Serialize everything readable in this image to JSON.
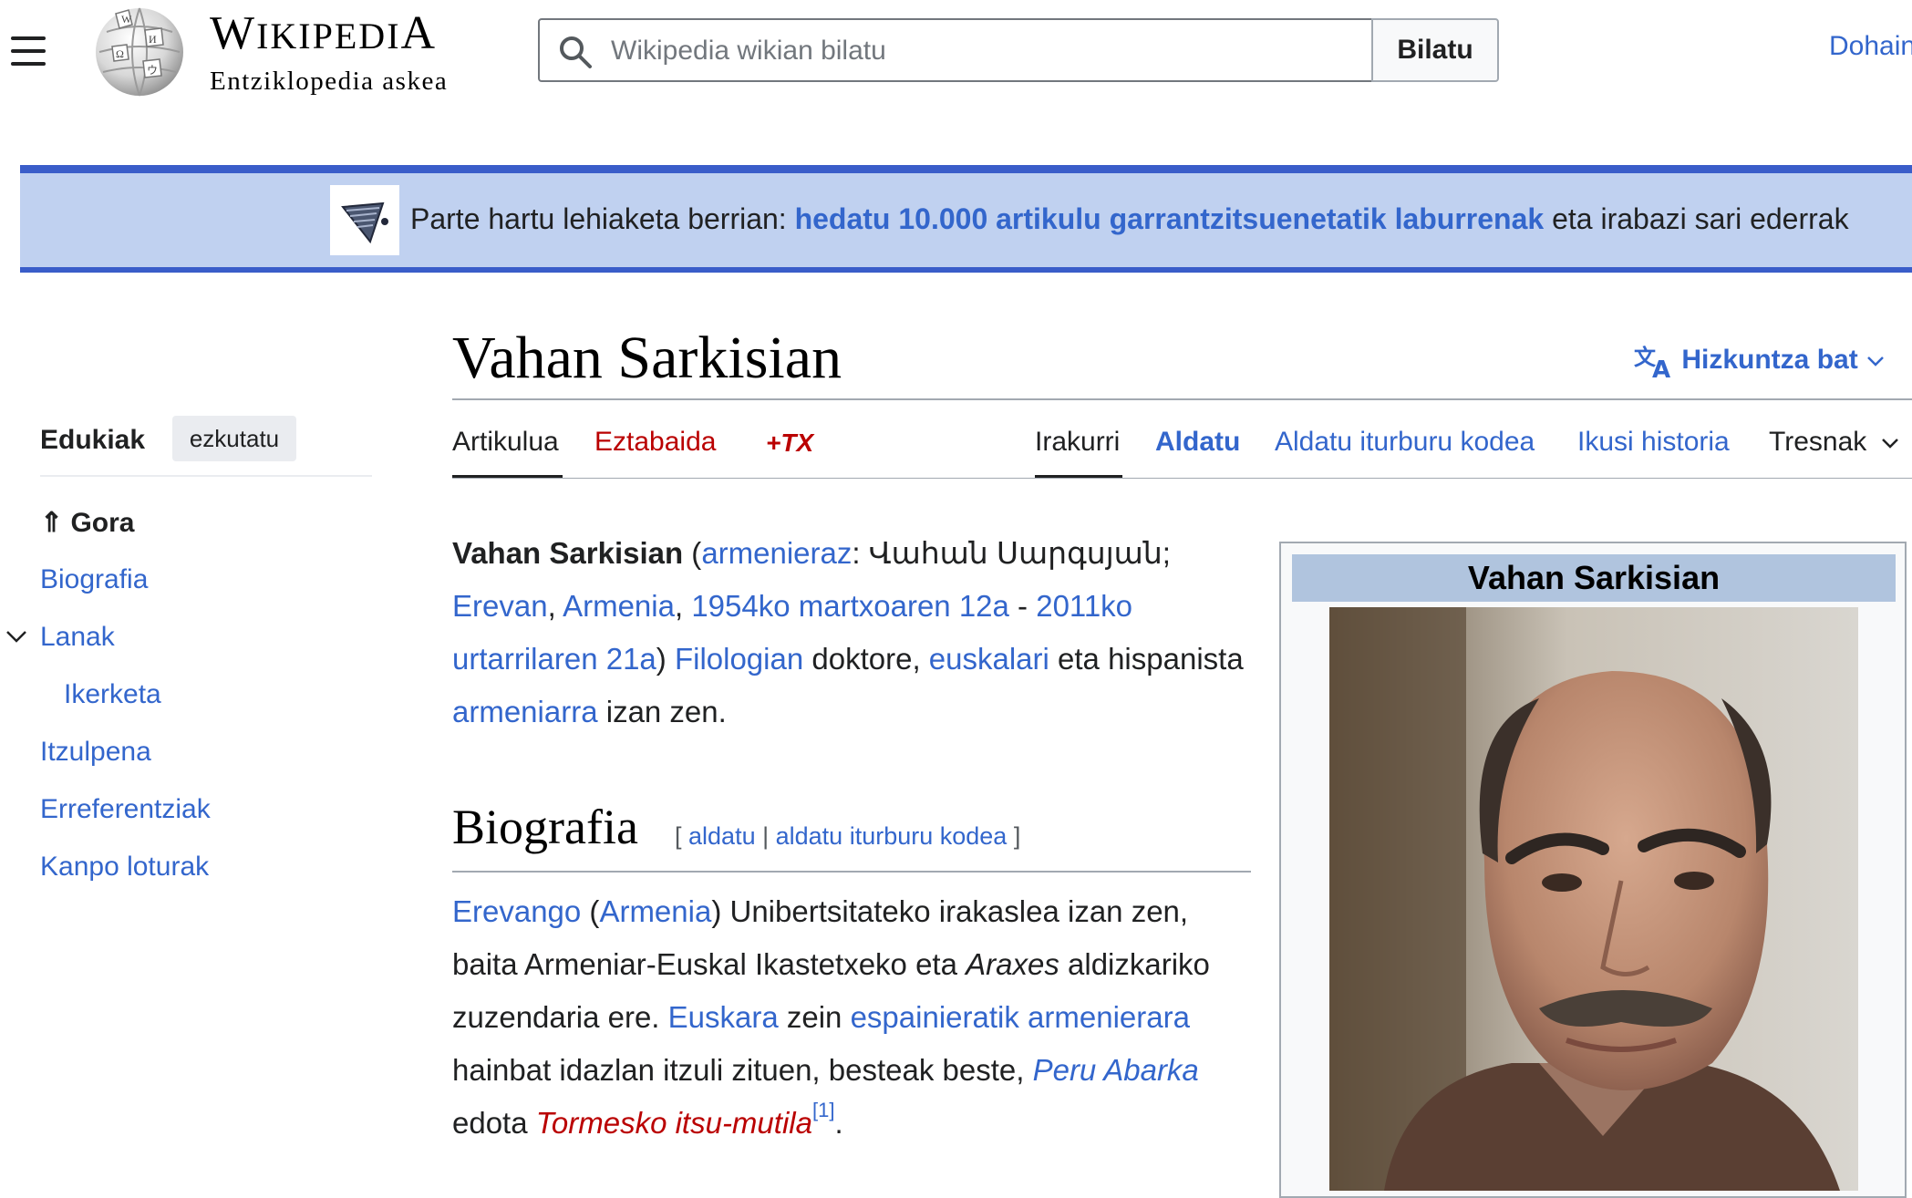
{
  "header": {
    "wordmark": "Wikipedia",
    "tagline": "Entziklopedia askea",
    "search_placeholder": "Wikipedia wikian bilatu",
    "search_button": "Bilatu",
    "donate": "Dohain"
  },
  "banner": {
    "prefix": "Parte hartu lehiaketa berrian: ",
    "link": "hedatu 10.000 artikulu garrantzitsuenetatik laburrenak",
    "suffix": " eta irabazi sari ederrak"
  },
  "toc": {
    "title": "Edukiak",
    "hide": "ezkutatu",
    "items": {
      "top": "⇑ Gora",
      "biografia": "Biografia",
      "lanak": "Lanak",
      "ikerketa": "Ikerketa",
      "itzulpena": "Itzulpena",
      "erreferentziak": "Erreferentziak",
      "kanpo": "Kanpo loturak"
    }
  },
  "article": {
    "title": "Vahan Sarkisian",
    "languages": "Hizkuntza bat",
    "tabs": {
      "artikulua": "Artikulua",
      "eztabaida": "Eztabaida",
      "tx": "+TX",
      "irakurri": "Irakurri",
      "aldatu": "Aldatu",
      "aldatu_kodea": "Aldatu iturburu kodea",
      "historia": "Ikusi historia",
      "tresnak": "Tresnak"
    },
    "intro": {
      "name": "Vahan Sarkisian",
      "p1": " (",
      "armenieraz": "armenieraz",
      "armenian_name": ": Վահան Սարգսյան;",
      "erevan": "Erevan",
      "comma1": ", ",
      "armenia": "Armenia",
      "comma2": ", ",
      "birth": "1954ko martxoaren 12a",
      "dash": " - ",
      "death": "2011ko urtarrilaren 21a",
      "p2": ") ",
      "filologian": "Filologian",
      "doktore": " doktore, ",
      "euskalari": "euskalari",
      "eta": " eta hispanista ",
      "armeniarra": "armeniarra",
      "izan": " izan zen."
    },
    "biografia": {
      "heading": "Biografia",
      "edit_open": "[ ",
      "edit": "aldatu",
      "edit_sep": " | ",
      "edit_source": "aldatu iturburu kodea",
      "edit_close": " ]",
      "erevango": "Erevango",
      "par_open": " (",
      "armenia": "Armenia",
      "t1": ") Unibertsitateko irakaslea izan zen, baita Armeniar-Euskal Ikastetxeko eta ",
      "araxes": "Araxes",
      "t2": " aldizkariko zuzendaria ere. ",
      "euskara": "Euskara",
      "zein": " zein ",
      "espainieratik": "espainieratik",
      "space": " ",
      "armenierara": "armenierara",
      "t3": " hainbat idazlan itzuli zituen, besteak beste, ",
      "peru": "Peru Abarka",
      "edota": " edota ",
      "tormesko": "Tormesko itsu-mutila",
      "ref": "[1]",
      "dot": "."
    }
  },
  "infobox": {
    "title": "Vahan Sarkisian"
  },
  "colors": {
    "link": "#3366cc",
    "redlink": "#ba0000",
    "banner_bg": "#c0d1f0",
    "banner_border": "#3a5dc9",
    "infobox_title_bg": "#b0c4de"
  }
}
